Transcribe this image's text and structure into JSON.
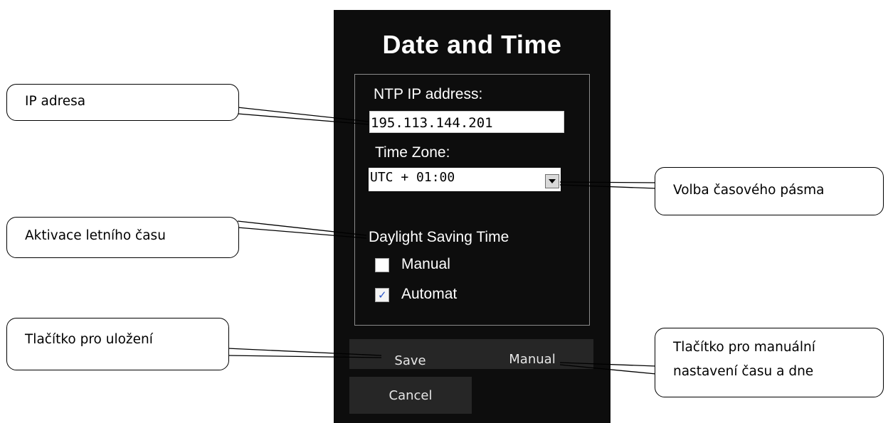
{
  "dialog": {
    "title": "Date and Time",
    "ntp_label": "NTP IP address:",
    "ntp_value": "195.113.144.201",
    "tz_label": "Time Zone:",
    "tz_value": "UTC + 01:00",
    "dst_label": "Daylight Saving Time",
    "options": [
      {
        "label": "Manual",
        "checked": false
      },
      {
        "label": "Automat",
        "checked": true
      }
    ],
    "buttons": {
      "save": "Save",
      "manual": "Manual",
      "cancel": "Cancel"
    }
  },
  "callouts": {
    "ip": "IP adresa",
    "dst": "Aktivace letního času",
    "save": "Tlačítko pro uložení",
    "timezone": "Volba časového pásma",
    "manual_line1": "Tlačítko pro manuální",
    "manual_line2": "nastavení času a dne"
  },
  "colors": {
    "panel_bg": "#0d0d0d",
    "checkmark": "#2a54c8"
  },
  "icons": {
    "dropdown": "triangle-down-icon",
    "check": "check-icon"
  }
}
